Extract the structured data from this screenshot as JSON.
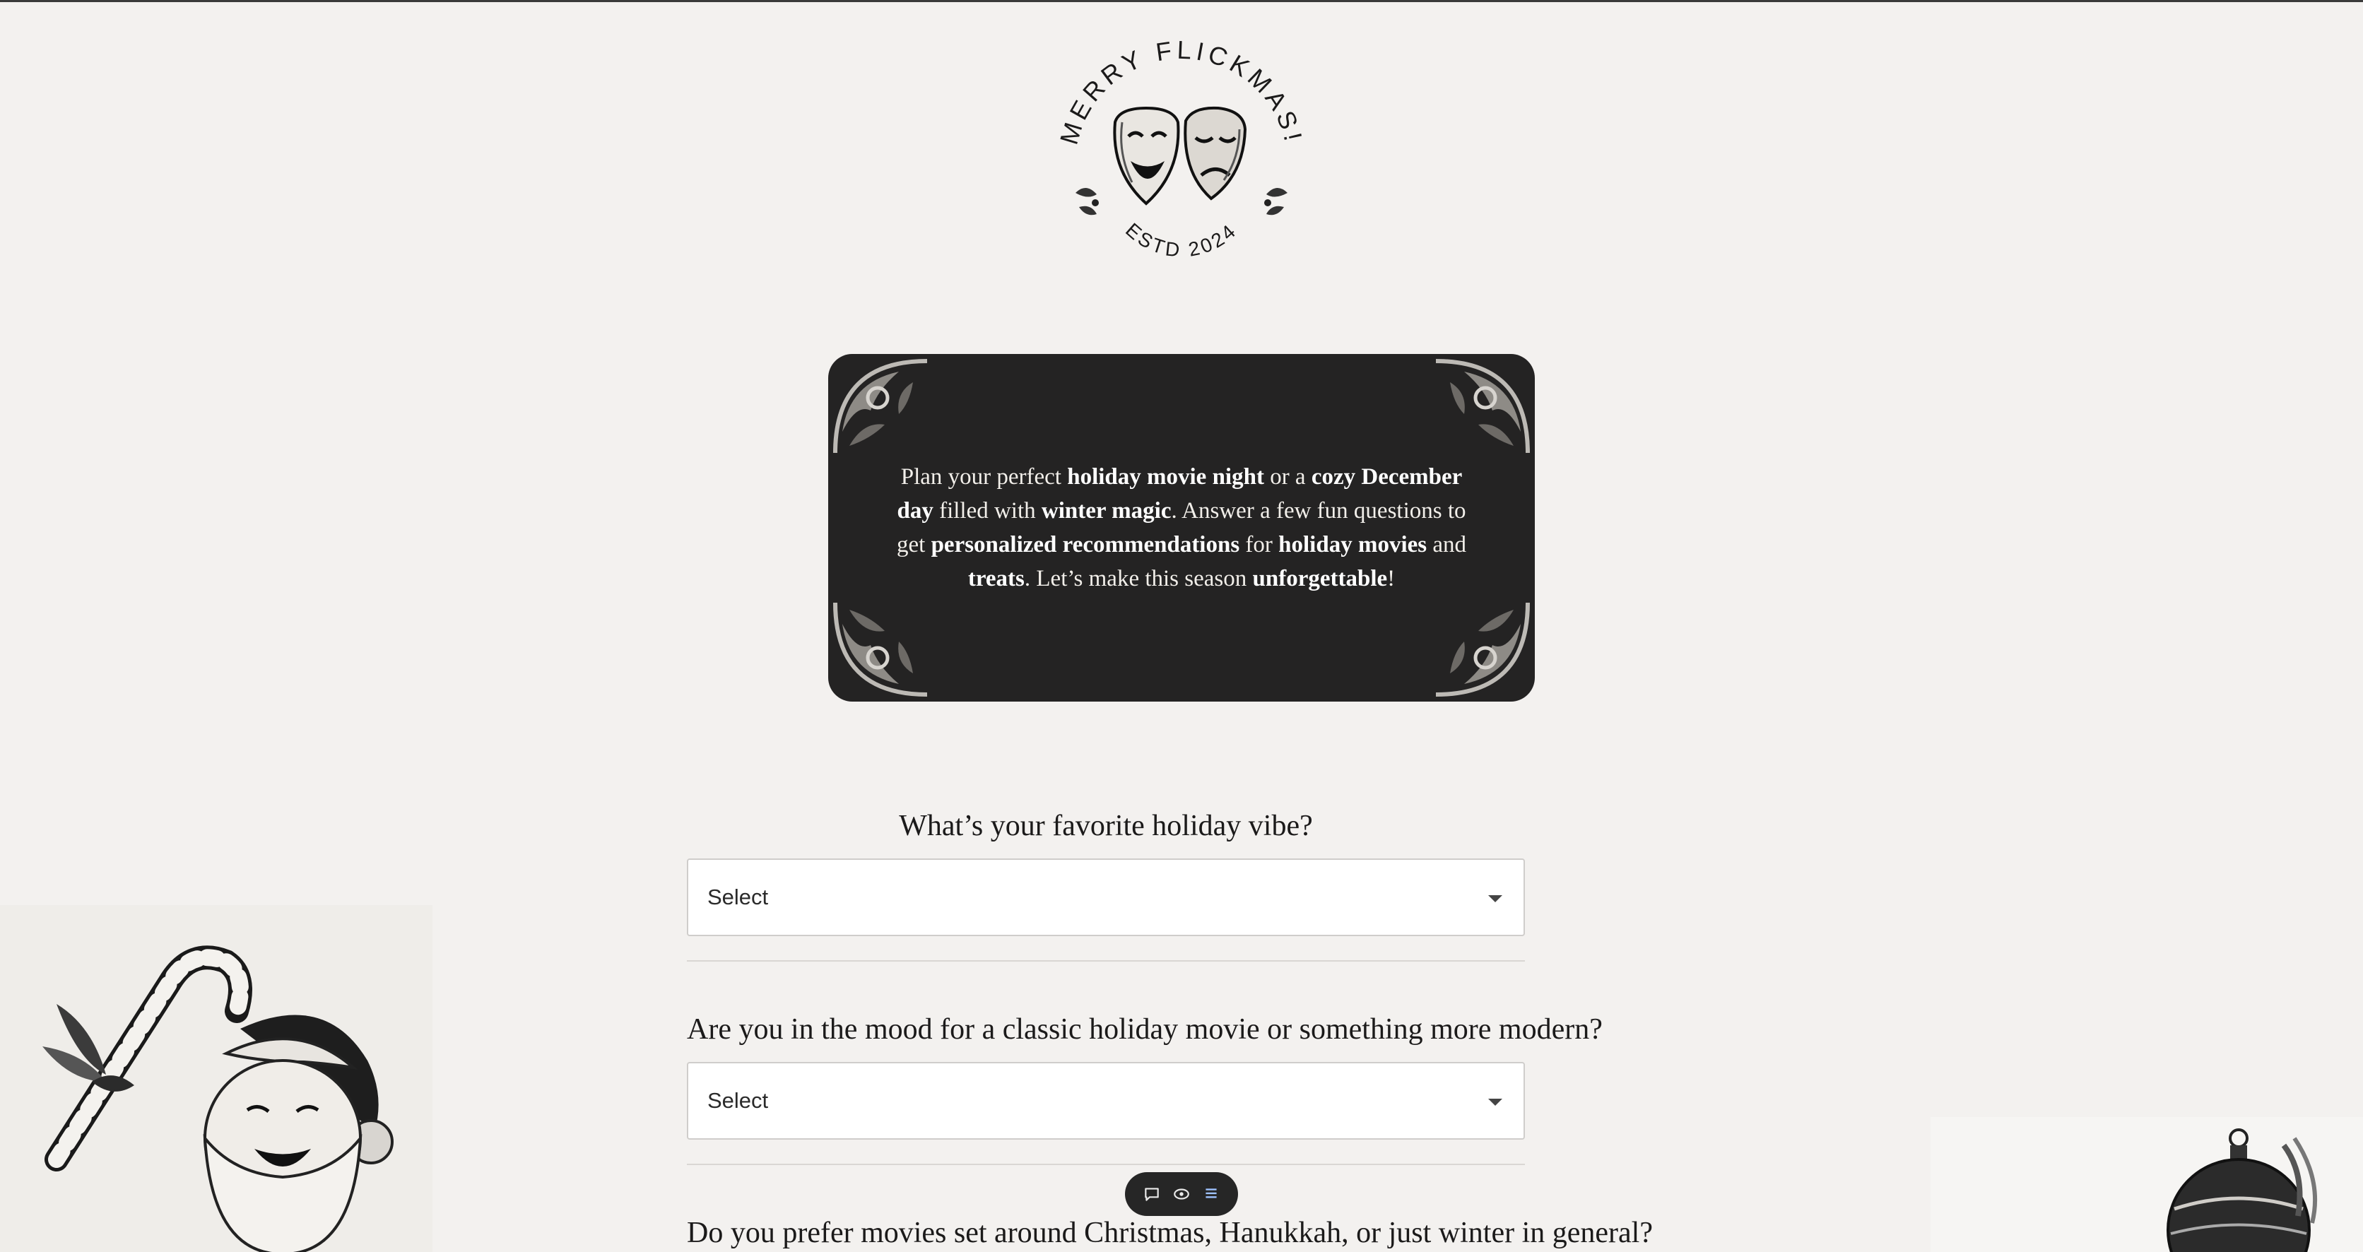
{
  "logo": {
    "title": "MERRY FLICKMAS!",
    "established": "ESTD 2024"
  },
  "intro": {
    "segments": [
      {
        "text": "Plan your perfect ",
        "bold": false
      },
      {
        "text": "holiday movie night",
        "bold": true
      },
      {
        "text": " or a ",
        "bold": false
      },
      {
        "text": "cozy December day",
        "bold": true
      },
      {
        "text": " filled with ",
        "bold": false
      },
      {
        "text": "winter magic",
        "bold": true
      },
      {
        "text": ". Answer a few fun questions to get ",
        "bold": false
      },
      {
        "text": "personalized recommendations",
        "bold": true
      },
      {
        "text": " for ",
        "bold": false
      },
      {
        "text": "holiday movies",
        "bold": true
      },
      {
        "text": " and ",
        "bold": false
      },
      {
        "text": "treats",
        "bold": true
      },
      {
        "text": ". Let’s make this season ",
        "bold": false
      },
      {
        "text": "unforgettable",
        "bold": true
      },
      {
        "text": "!",
        "bold": false
      }
    ]
  },
  "questions": [
    {
      "label": "What’s your favorite holiday vibe?",
      "select_value": "Select"
    },
    {
      "label": "Are you in the mood for a classic holiday movie or something more modern?",
      "select_value": "Select"
    },
    {
      "label": "Do you prefer movies set around Christmas, Hanukkah, or just winter in general?",
      "select_value": "Select"
    }
  ],
  "toolbar": {
    "icons": [
      "comment-icon",
      "eye-icon",
      "list-icon"
    ]
  },
  "colors": {
    "background": "#f3f1ef",
    "card": "#242323",
    "card_text": "#f2efea",
    "toolbar": "#262626"
  }
}
